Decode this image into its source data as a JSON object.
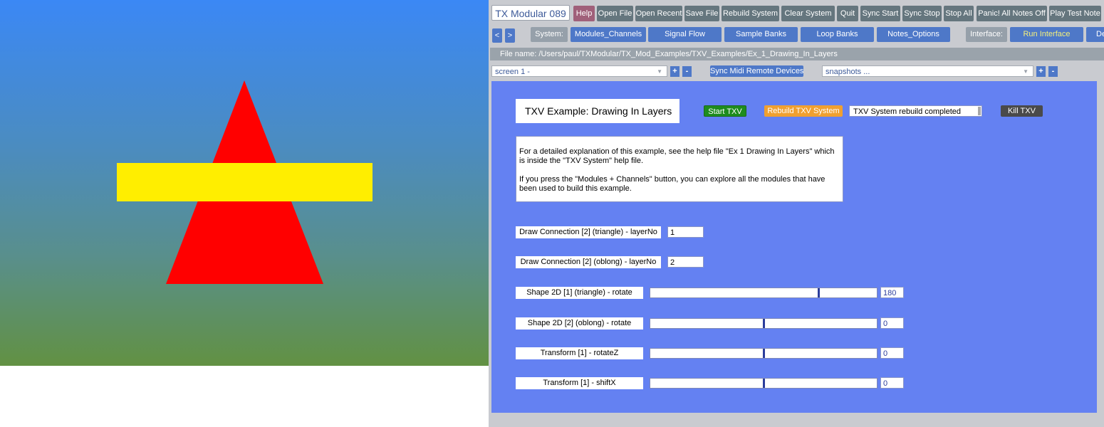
{
  "toolbar": {
    "title": "TX Modular 089",
    "buttons": [
      "Help",
      "Open File",
      "Open Recent",
      "Save File",
      "Rebuild System",
      "Clear System",
      "Quit",
      "Sync Start",
      "Sync Stop",
      "Stop All",
      "Panic! All Notes Off",
      "Play Test Note"
    ]
  },
  "nav": {
    "prev": "<",
    "next": ">",
    "system_label": "System:",
    "system_buttons": [
      "Modules_Channels",
      "Signal Flow",
      "Sample Banks",
      "Loop Banks",
      "Notes_Options"
    ],
    "interface_label": "Interface:",
    "run_interface": "Run Interface",
    "cut_button": "De"
  },
  "file_bar": "File name: /Users/paul/TXModular/TX_Mod_Examples/TXV_Examples/Ex_1_Drawing_In_Layers",
  "screen_row": {
    "screen_select": "screen 1 -",
    "plus": "+",
    "minus": "-",
    "sync_button": "Sync Midi Remote Devices",
    "snapshots_select": "snapshots ..."
  },
  "panel": {
    "title": "TXV Example:  Drawing In Layers",
    "start_button": "Start TXV",
    "rebuild_button": "Rebuild TXV System",
    "status_text": "TXV System rebuild completed",
    "kill_button": "Kill TXV",
    "description_1": "For a detailed explanation of this example, see the help file \"Ex 1 Drawing In Layers\" which is inside the \"TXV System\" help file.",
    "description_2": "If you press the \"Modules + Channels\" button, you can explore all the modules that have been used to build this example.",
    "layer_params": [
      {
        "label": "Draw Connection [2] (triangle) - layerNo",
        "value": "1"
      },
      {
        "label": "Draw Connection [2] (oblong) - layerNo",
        "value": "2"
      }
    ],
    "slider_params": [
      {
        "label": "Shape 2D [1] (triangle) - rotate",
        "value": "180",
        "level": 0.745
      },
      {
        "label": "Shape 2D [2] (oblong) - rotate",
        "value": "0",
        "level": 0.5
      },
      {
        "label": "Transform [1]  - rotateZ",
        "value": "0",
        "level": 0.5
      },
      {
        "label": "Transform [1]  - shiftX",
        "value": "0",
        "level": 0.5
      }
    ]
  },
  "colors": {
    "triangle": "#ff0000",
    "oblong": "#ffee00",
    "panel_bg": "#6481f2",
    "start_green": "#1e8c1e",
    "rebuild_orange": "#f0a030",
    "kill_dark": "#4a4a4a"
  },
  "icons": {
    "dropdown": "chevron-down-icon"
  }
}
